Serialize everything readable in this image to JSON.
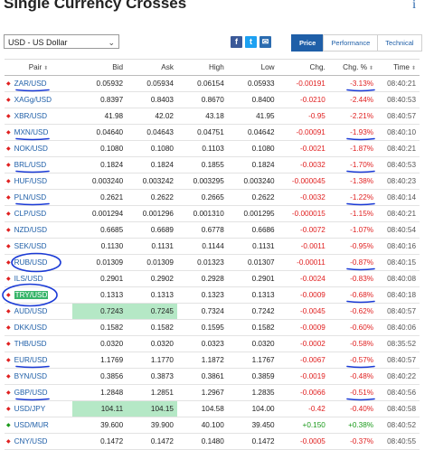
{
  "page": {
    "title": "Single Currency Crosses",
    "info_icon": "i",
    "currency_select": "USD - US Dollar"
  },
  "toolbar": {
    "share_facebook": "f",
    "share_twitter": "t",
    "share_email": "✉",
    "tabs": [
      "Price",
      "Performance",
      "Technical"
    ],
    "active_tab": "Price"
  },
  "table": {
    "columns": [
      "Pair",
      "Bid",
      "Ask",
      "High",
      "Low",
      "Chg.",
      "Chg. %",
      "Time"
    ],
    "rows": [
      {
        "pair": "ZAR/USD",
        "bid": "0.05932",
        "ask": "0.05934",
        "high": "0.06154",
        "low": "0.05933",
        "chg": "-0.00191",
        "chgpct": "-3.13%",
        "time": "08:40:21",
        "dir": "down"
      },
      {
        "pair": "XAGg/USD",
        "bid": "0.8397",
        "ask": "0.8403",
        "high": "0.8670",
        "low": "0.8400",
        "chg": "-0.0210",
        "chgpct": "-2.44%",
        "time": "08:40:53",
        "dir": "down"
      },
      {
        "pair": "XBR/USD",
        "bid": "41.98",
        "ask": "42.02",
        "high": "43.18",
        "low": "41.95",
        "chg": "-0.95",
        "chgpct": "-2.21%",
        "time": "08:40:57",
        "dir": "down"
      },
      {
        "pair": "MXN/USD",
        "bid": "0.04640",
        "ask": "0.04643",
        "high": "0.04751",
        "low": "0.04642",
        "chg": "-0.00091",
        "chgpct": "-1.93%",
        "time": "08:40:10",
        "dir": "down"
      },
      {
        "pair": "NOK/USD",
        "bid": "0.1080",
        "ask": "0.1080",
        "high": "0.1103",
        "low": "0.1080",
        "chg": "-0.0021",
        "chgpct": "-1.87%",
        "time": "08:40:21",
        "dir": "down"
      },
      {
        "pair": "BRL/USD",
        "bid": "0.1824",
        "ask": "0.1824",
        "high": "0.1855",
        "low": "0.1824",
        "chg": "-0.0032",
        "chgpct": "-1.70%",
        "time": "08:40:53",
        "dir": "down"
      },
      {
        "pair": "HUF/USD",
        "bid": "0.003240",
        "ask": "0.003242",
        "high": "0.003295",
        "low": "0.003240",
        "chg": "-0.000045",
        "chgpct": "-1.38%",
        "time": "08:40:23",
        "dir": "down"
      },
      {
        "pair": "PLN/USD",
        "bid": "0.2621",
        "ask": "0.2622",
        "high": "0.2665",
        "low": "0.2622",
        "chg": "-0.0032",
        "chgpct": "-1.22%",
        "time": "08:40:14",
        "dir": "down"
      },
      {
        "pair": "CLP/USD",
        "bid": "0.001294",
        "ask": "0.001296",
        "high": "0.001310",
        "low": "0.001295",
        "chg": "-0.000015",
        "chgpct": "-1.15%",
        "time": "08:40:21",
        "dir": "down"
      },
      {
        "pair": "NZD/USD",
        "bid": "0.6685",
        "ask": "0.6689",
        "high": "0.6778",
        "low": "0.6686",
        "chg": "-0.0072",
        "chgpct": "-1.07%",
        "time": "08:40:54",
        "dir": "down"
      },
      {
        "pair": "SEK/USD",
        "bid": "0.1130",
        "ask": "0.1131",
        "high": "0.1144",
        "low": "0.1131",
        "chg": "-0.0011",
        "chgpct": "-0.95%",
        "time": "08:40:16",
        "dir": "down"
      },
      {
        "pair": "RUB/USD",
        "bid": "0.01309",
        "ask": "0.01309",
        "high": "0.01323",
        "low": "0.01307",
        "chg": "-0.00011",
        "chgpct": "-0.87%",
        "time": "08:40:15",
        "dir": "down"
      },
      {
        "pair": "ILS/USD",
        "bid": "0.2901",
        "ask": "0.2902",
        "high": "0.2928",
        "low": "0.2901",
        "chg": "-0.0024",
        "chgpct": "-0.83%",
        "time": "08:40:08",
        "dir": "down"
      },
      {
        "pair": "TRY/USD",
        "bid": "0.1313",
        "ask": "0.1313",
        "high": "0.1323",
        "low": "0.1313",
        "chg": "-0.0009",
        "chgpct": "-0.68%",
        "time": "08:40:18",
        "dir": "down"
      },
      {
        "pair": "AUD/USD",
        "bid": "0.7243",
        "ask": "0.7245",
        "high": "0.7324",
        "low": "0.7242",
        "chg": "-0.0045",
        "chgpct": "-0.62%",
        "time": "08:40:57",
        "dir": "down"
      },
      {
        "pair": "DKK/USD",
        "bid": "0.1582",
        "ask": "0.1582",
        "high": "0.1595",
        "low": "0.1582",
        "chg": "-0.0009",
        "chgpct": "-0.60%",
        "time": "08:40:06",
        "dir": "down"
      },
      {
        "pair": "THB/USD",
        "bid": "0.0320",
        "ask": "0.0320",
        "high": "0.0323",
        "low": "0.0320",
        "chg": "-0.0002",
        "chgpct": "-0.58%",
        "time": "08:35:52",
        "dir": "down"
      },
      {
        "pair": "EUR/USD",
        "bid": "1.1769",
        "ask": "1.1770",
        "high": "1.1872",
        "low": "1.1767",
        "chg": "-0.0067",
        "chgpct": "-0.57%",
        "time": "08:40:57",
        "dir": "down"
      },
      {
        "pair": "BYN/USD",
        "bid": "0.3856",
        "ask": "0.3873",
        "high": "0.3861",
        "low": "0.3859",
        "chg": "-0.0019",
        "chgpct": "-0.48%",
        "time": "08:40:22",
        "dir": "down"
      },
      {
        "pair": "GBP/USD",
        "bid": "1.2848",
        "ask": "1.2851",
        "high": "1.2967",
        "low": "1.2835",
        "chg": "-0.0066",
        "chgpct": "-0.51%",
        "time": "08:40:56",
        "dir": "down"
      },
      {
        "pair": "USD/JPY",
        "bid": "104.11",
        "ask": "104.15",
        "high": "104.58",
        "low": "104.00",
        "chg": "-0.42",
        "chgpct": "-0.40%",
        "time": "08:40:58",
        "dir": "down"
      },
      {
        "pair": "USD/MUR",
        "bid": "39.600",
        "ask": "39.900",
        "high": "40.100",
        "low": "39.450",
        "chg": "+0.150",
        "chgpct": "+0.38%",
        "time": "08:40:52",
        "dir": "up"
      },
      {
        "pair": "CNY/USD",
        "bid": "0.1472",
        "ask": "0.1472",
        "high": "0.1480",
        "low": "0.1472",
        "chg": "-0.0005",
        "chgpct": "-0.37%",
        "time": "08:40:55",
        "dir": "down"
      }
    ]
  },
  "colors": {
    "link": "#1f5fa8",
    "negative": "#e02020",
    "positive": "#1a9a1a",
    "highlight": "#b5e8c6",
    "annotation": "#1a3ad6"
  }
}
